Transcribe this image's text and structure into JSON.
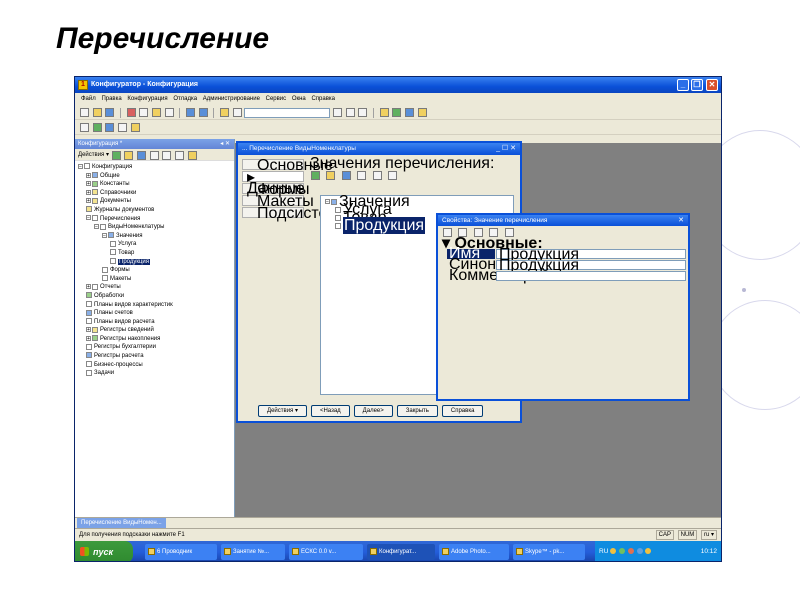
{
  "slide": {
    "title": "Перечисление"
  },
  "window": {
    "title": "Конфигуратор - Конфигурация"
  },
  "menu": [
    "Файл",
    "Правка",
    "Конфигурация",
    "Отладка",
    "Администрирование",
    "Сервис",
    "Окна",
    "Справка"
  ],
  "config_panel": {
    "title": "Конфигурация *",
    "controls": "◂ ✕",
    "actions_label": "Действия ▾",
    "tree": [
      {
        "label": "Конфигурация",
        "depth": 0,
        "expander": "−",
        "icon": "doc"
      },
      {
        "label": "Общие",
        "depth": 1,
        "expander": "+",
        "icon": "blue"
      },
      {
        "label": "Константы",
        "depth": 1,
        "expander": "+",
        "icon": "green"
      },
      {
        "label": "Справочники",
        "depth": 1,
        "expander": "+",
        "icon": "yellow"
      },
      {
        "label": "Документы",
        "depth": 1,
        "expander": "+",
        "icon": "yellow"
      },
      {
        "label": "Журналы документов",
        "depth": 1,
        "expander": "",
        "icon": "yellow"
      },
      {
        "label": "Перечисления",
        "depth": 1,
        "expander": "−",
        "icon": "doc"
      },
      {
        "label": "ВидыНоменклатуры",
        "depth": 2,
        "expander": "−",
        "icon": "doc"
      },
      {
        "label": "Значения",
        "depth": 3,
        "expander": "−",
        "icon": "blue"
      },
      {
        "label": "Услуга",
        "depth": 4,
        "expander": "",
        "icon": "line"
      },
      {
        "label": "Товар",
        "depth": 4,
        "expander": "",
        "icon": "line"
      },
      {
        "label": "Продукция",
        "depth": 4,
        "expander": "",
        "icon": "line",
        "selected": true
      },
      {
        "label": "Формы",
        "depth": 3,
        "expander": "",
        "icon": "doc"
      },
      {
        "label": "Макеты",
        "depth": 3,
        "expander": "",
        "icon": "doc"
      },
      {
        "label": "Отчеты",
        "depth": 1,
        "expander": "+",
        "icon": "doc"
      },
      {
        "label": "Обработки",
        "depth": 1,
        "expander": "",
        "icon": "green"
      },
      {
        "label": "Планы видов характеристик",
        "depth": 1,
        "expander": "",
        "icon": "doc"
      },
      {
        "label": "Планы счетов",
        "depth": 1,
        "expander": "",
        "icon": "blue"
      },
      {
        "label": "Планы видов расчета",
        "depth": 1,
        "expander": "",
        "icon": "doc"
      },
      {
        "label": "Регистры сведений",
        "depth": 1,
        "expander": "+",
        "icon": "yellow"
      },
      {
        "label": "Регистры накопления",
        "depth": 1,
        "expander": "+",
        "icon": "green"
      },
      {
        "label": "Регистры бухгалтерии",
        "depth": 1,
        "expander": "",
        "icon": "doc"
      },
      {
        "label": "Регистры расчета",
        "depth": 1,
        "expander": "",
        "icon": "blue"
      },
      {
        "label": "Бизнес-процессы",
        "depth": 1,
        "expander": "",
        "icon": "doc"
      },
      {
        "label": "Задачи",
        "depth": 1,
        "expander": "",
        "icon": "doc"
      }
    ]
  },
  "enum_window": {
    "title": "... Перечисление ВидыНоменклатуры",
    "controls": "_ ☐ ✕",
    "tabs": [
      "Основные",
      "▸ Данные",
      "Формы",
      "Макеты",
      "Подсистемы"
    ],
    "active_tab_index": 1,
    "values_label": "Значения перечисления:",
    "tree": [
      {
        "label": "Значения",
        "depth": 0,
        "expander": "−"
      },
      {
        "label": "Услуга",
        "depth": 1
      },
      {
        "label": "Товар",
        "depth": 1
      },
      {
        "label": "Продукция",
        "depth": 1,
        "selected": true
      }
    ],
    "buttons": [
      "Действия ▾",
      "<Назад",
      "Далее>",
      "Закрыть",
      "Справка"
    ]
  },
  "properties_window": {
    "title": "Свойства: Значение перечисления",
    "controls": "✕",
    "section": "▾ Основные:",
    "rows": [
      {
        "name": "Имя",
        "value": "Продукция",
        "selected": true
      },
      {
        "name": "Синоним",
        "value": "Продукция"
      },
      {
        "name": "Комментарий",
        "value": ""
      }
    ]
  },
  "bottom_tab": "Перечисление ВидыНомен...",
  "statusbar": {
    "hint": "Для получения подсказки нажмите F1",
    "indicators": [
      "CAP",
      "NUM",
      "ru ▾"
    ]
  },
  "taskbar": {
    "start_label": "пуск",
    "tasks": [
      {
        "label": "6 Проводник",
        "active": false
      },
      {
        "label": "Занятие №...",
        "active": false
      },
      {
        "label": "ЕСКС 0.0 v...",
        "active": false
      },
      {
        "label": "Конфигурат...",
        "active": true
      },
      {
        "label": "Adobe Photo...",
        "active": false
      },
      {
        "label": "Skype™ - pk...",
        "active": false
      }
    ],
    "language": "RU",
    "clock": "10:12"
  }
}
